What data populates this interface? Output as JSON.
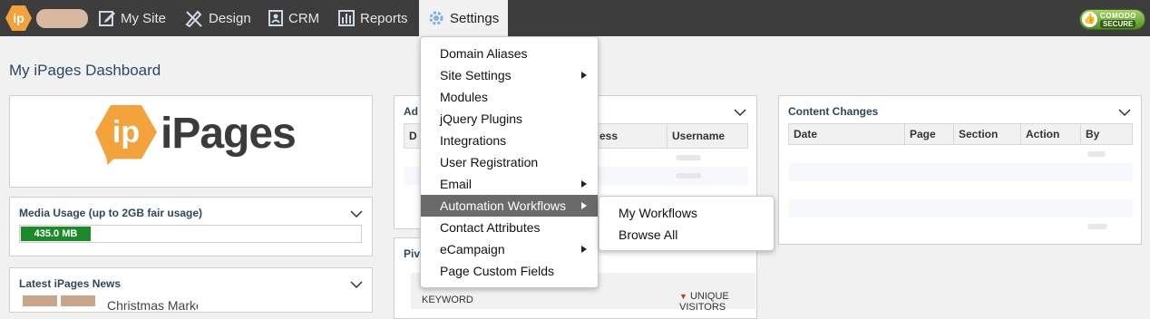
{
  "nav": {
    "logo": "ip",
    "items": [
      {
        "label": "My Site",
        "icon": "edit-icon"
      },
      {
        "label": "Design",
        "icon": "design-tools-icon"
      },
      {
        "label": "CRM",
        "icon": "contacts-book-icon"
      },
      {
        "label": "Reports",
        "icon": "bar-chart-icon"
      },
      {
        "label": "Settings",
        "icon": "gear-icon"
      }
    ],
    "secure_badge": {
      "line1": "COMODO",
      "line2": "SECURE"
    }
  },
  "page_title": "My iPages Dashboard",
  "brand": {
    "mark": "ip",
    "word": "iPages"
  },
  "media_usage": {
    "title": "Media Usage (up to 2GB fair usage)",
    "value_label": "435.0 MB",
    "fraction": 0.207
  },
  "news": {
    "title": "Latest iPages News",
    "headline": "Christmas Marketing Tips"
  },
  "admin_panel": {
    "title": "Ad",
    "columns": [
      "D",
      "ess",
      "Username"
    ]
  },
  "pivot_panel": {
    "title": "Piv",
    "keyword_label": "KEYWORD",
    "sort_label": "UNIQUE VISITORS"
  },
  "content_changes": {
    "title": "Content Changes",
    "columns": [
      "Date",
      "Page",
      "Section",
      "Action",
      "By"
    ]
  },
  "settings_menu": {
    "items": [
      {
        "label": "Domain Aliases",
        "submenu": false
      },
      {
        "label": "Site Settings",
        "submenu": true
      },
      {
        "label": "Modules",
        "submenu": false
      },
      {
        "label": "jQuery Plugins",
        "submenu": false
      },
      {
        "label": "Integrations",
        "submenu": false
      },
      {
        "label": "User Registration",
        "submenu": false
      },
      {
        "label": "Email",
        "submenu": true
      },
      {
        "label": "Automation Workflows",
        "submenu": true
      },
      {
        "label": "Contact Attributes",
        "submenu": false
      },
      {
        "label": "eCampaign",
        "submenu": true
      },
      {
        "label": "Page Custom Fields",
        "submenu": false
      }
    ],
    "highlighted": "Automation Workflows",
    "submenu_items": [
      "My Workflows",
      "Browse All"
    ]
  },
  "colors": {
    "topbar": "#3d3d3d",
    "accent": "#f4a23c",
    "usage_fill": "#1c8a28",
    "menu_highlight": "#6a6a6a",
    "title_blue": "#2c4760"
  }
}
